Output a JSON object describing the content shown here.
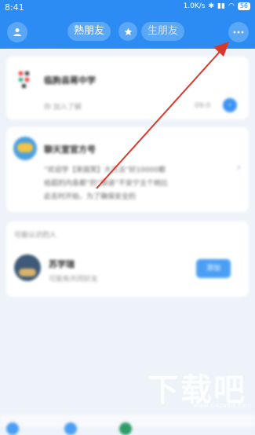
{
  "status_bar": {
    "time": "8:41",
    "network_speed": "1.0K/s",
    "battery": "56"
  },
  "header": {
    "tab_familiar": "熟朋友",
    "tab_stranger": "生朋友"
  },
  "feed": {
    "card1": {
      "title": "临朐县蒋中学",
      "subtitle": "你 加入了解",
      "time": "09:0"
    },
    "card2": {
      "title": "聊天室官方号",
      "lines": [
        "“欢迎学【来搞笑】大方法”好10000都",
        "给超的内各都”的“那道”不安宁主个她比",
        "此名时开始，为了确保安全的"
      ]
    },
    "card3": {
      "section_label": "可能认识的人",
      "name": "苏学瑞",
      "subtitle": "可能有共同好友",
      "add_button": "添加"
    }
  },
  "watermark": {
    "text": "下载吧",
    "sub": "www.xiazaiba.com"
  },
  "colors": {
    "primary": "#2d8cf3",
    "annotation_arrow": "#d9382a"
  }
}
